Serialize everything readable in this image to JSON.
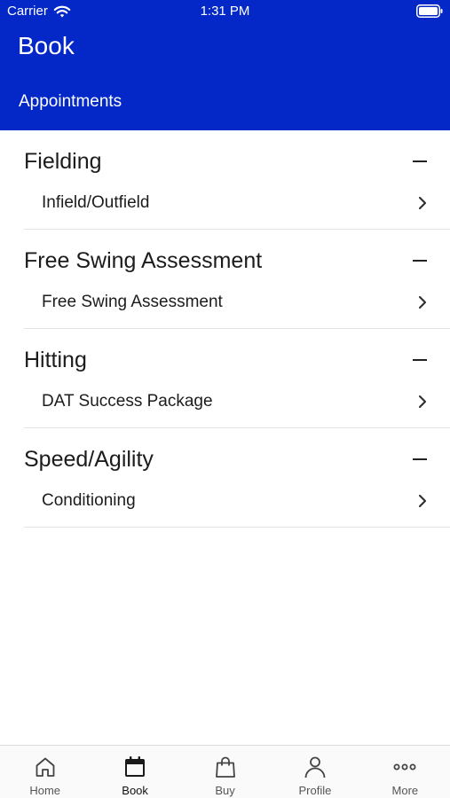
{
  "status_bar": {
    "carrier": "Carrier",
    "time": "1:31 PM"
  },
  "header": {
    "title": "Book",
    "section": "Appointments",
    "background_color": "#0328c7"
  },
  "groups": [
    {
      "title": "Fielding",
      "item": "Infield/Outfield"
    },
    {
      "title": "Free Swing Assessment",
      "item": "Free Swing Assessment"
    },
    {
      "title": "Hitting",
      "item": "DAT Success Package"
    },
    {
      "title": "Speed/Agility",
      "item": "Conditioning"
    }
  ],
  "tab_bar": {
    "active": "Book",
    "tabs": [
      {
        "label": "Home",
        "icon": "home-icon"
      },
      {
        "label": "Book",
        "icon": "calendar-icon"
      },
      {
        "label": "Buy",
        "icon": "shopping-bag-icon"
      },
      {
        "label": "Profile",
        "icon": "person-icon"
      },
      {
        "label": "More",
        "icon": "more-dots-icon"
      }
    ]
  }
}
